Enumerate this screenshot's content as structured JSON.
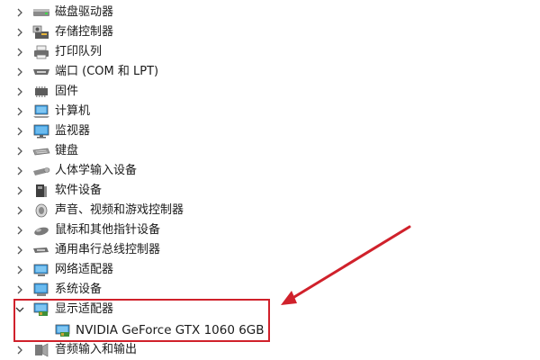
{
  "tree": {
    "categories": [
      {
        "label": "磁盘驱动器",
        "icon": "disk-drive-icon",
        "expanded": false
      },
      {
        "label": "存储控制器",
        "icon": "storage-controller-icon",
        "expanded": false
      },
      {
        "label": "打印队列",
        "icon": "printer-icon",
        "expanded": false
      },
      {
        "label": "端口 (COM 和 LPT)",
        "icon": "port-icon",
        "expanded": false
      },
      {
        "label": "固件",
        "icon": "firmware-icon",
        "expanded": false
      },
      {
        "label": "计算机",
        "icon": "computer-icon",
        "expanded": false
      },
      {
        "label": "监视器",
        "icon": "monitor-icon",
        "expanded": false
      },
      {
        "label": "键盘",
        "icon": "keyboard-icon",
        "expanded": false
      },
      {
        "label": "人体学输入设备",
        "icon": "hid-icon",
        "expanded": false
      },
      {
        "label": "软件设备",
        "icon": "software-device-icon",
        "expanded": false
      },
      {
        "label": "声音、视频和游戏控制器",
        "icon": "speaker-icon",
        "expanded": false
      },
      {
        "label": "鼠标和其他指针设备",
        "icon": "mouse-icon",
        "expanded": false
      },
      {
        "label": "通用串行总线控制器",
        "icon": "usb-icon",
        "expanded": false
      },
      {
        "label": "网络适配器",
        "icon": "network-adapter-icon",
        "expanded": false
      },
      {
        "label": "系统设备",
        "icon": "system-device-icon",
        "expanded": false
      },
      {
        "label": "显示适配器",
        "icon": "display-adapter-icon",
        "expanded": true
      },
      {
        "label": "音频输入和输出",
        "icon": "audio-io-icon",
        "expanded": false
      }
    ],
    "display_adapter_child": {
      "label": "NVIDIA GeForce GTX 1060 6GB",
      "icon": "display-adapter-icon"
    }
  },
  "annotation": {
    "color": "#d0212b"
  }
}
